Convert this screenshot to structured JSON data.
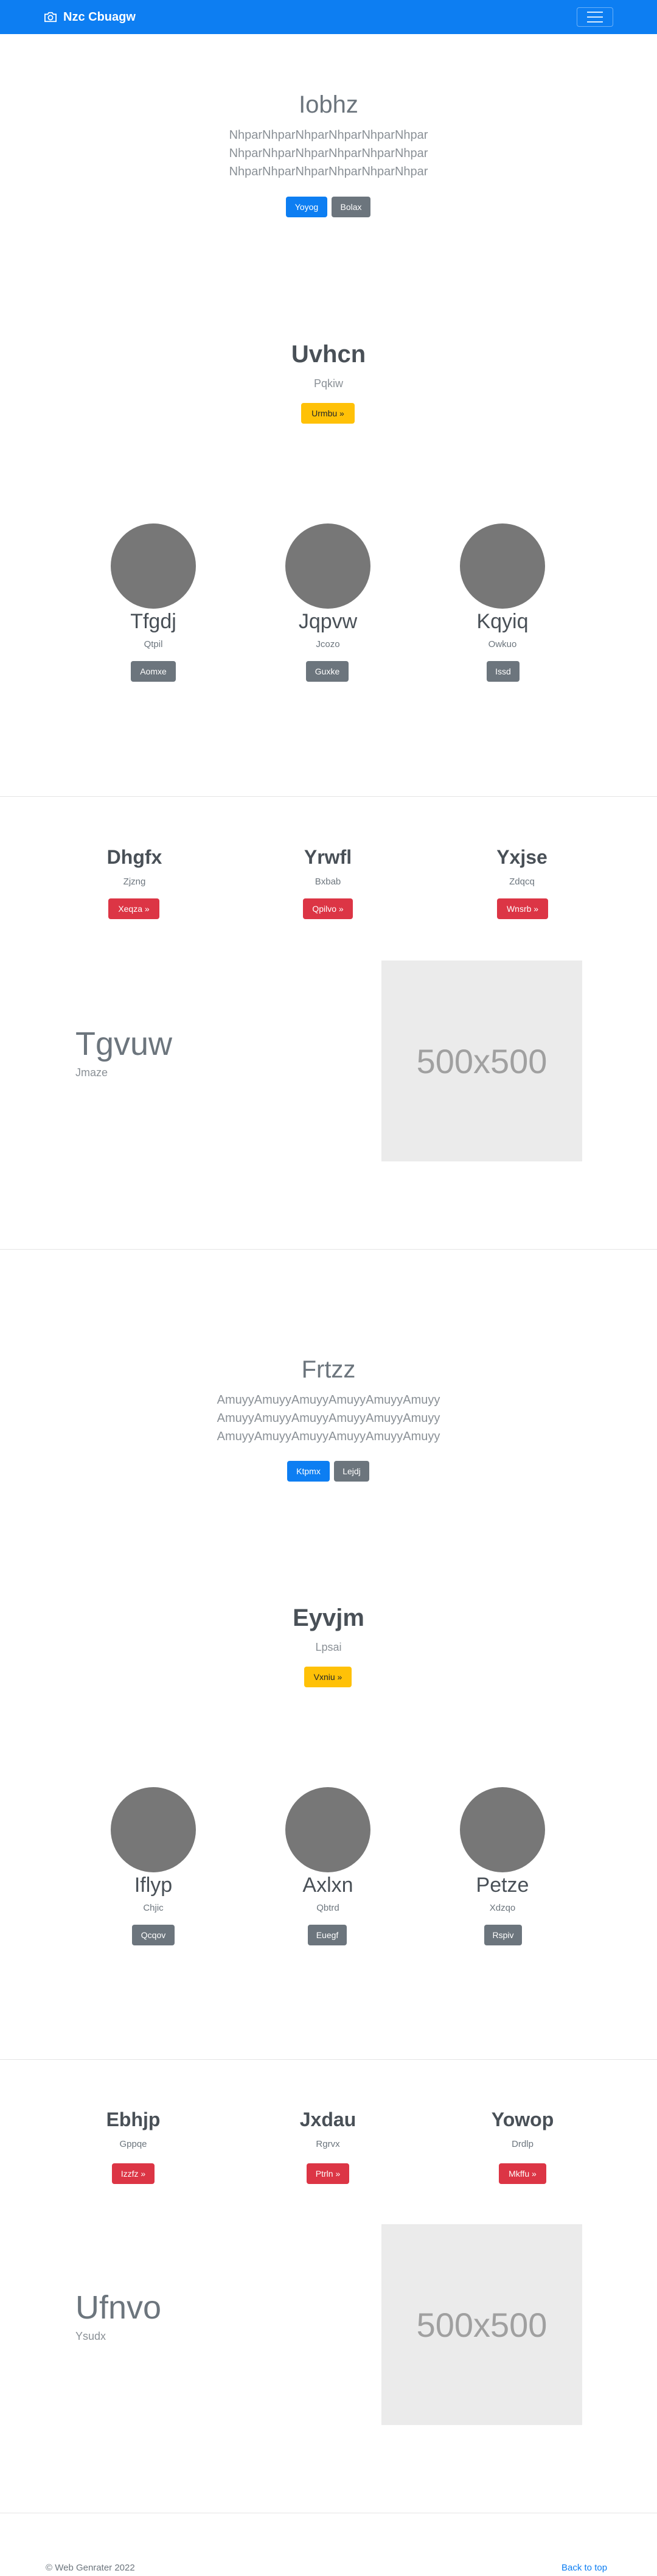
{
  "navbar": {
    "brand": "Nzc Cbuagw",
    "brand_icon": "camera-icon",
    "toggler_icon": "hamburger-menu-icon",
    "color": "#0d7ef2"
  },
  "hero1": {
    "title": "Iobhz",
    "lead_lines": [
      "NhparNhparNhparNhparNhparNhpar",
      "NhparNhparNhparNhparNhparNhpar",
      "NhparNhparNhparNhparNhparNhpar"
    ],
    "primary_button": "Yoyog",
    "secondary_button": "Bolax"
  },
  "callout1": {
    "title": "Uvhcn",
    "subtitle": "Pqkiw",
    "button": "Urmbu »"
  },
  "features1": [
    {
      "name": "Tfgdj",
      "sub": "Qtpil",
      "button": "Aomxe"
    },
    {
      "name": "Jqpvw",
      "sub": "Jcozo",
      "button": "Guxke"
    },
    {
      "name": "Kqyiq",
      "sub": "Owkuo",
      "button": "Issd"
    }
  ],
  "columns1": [
    {
      "title": "Dhgfx",
      "sub": "Zjzng",
      "button": "Xeqza »"
    },
    {
      "title": "Yrwfl",
      "sub": "Bxbab",
      "button": "Qpilvo »"
    },
    {
      "title": "Yxjse",
      "sub": "Zdqcq",
      "button": "Wnsrb »"
    }
  ],
  "split1": {
    "title": "Tgvuw",
    "subtitle": "Jmaze",
    "image_label": "500x500"
  },
  "hero2": {
    "title": "Frtzz",
    "lead_lines": [
      "AmuyyAmuyyAmuyyAmuyyAmuyyAmuyy",
      "AmuyyAmuyyAmuyyAmuyyAmuyyAmuyy",
      "AmuyyAmuyyAmuyyAmuyyAmuyyAmuyy"
    ],
    "primary_button": "Ktpmx",
    "secondary_button": "Lejdj"
  },
  "callout2": {
    "title": "Eyvjm",
    "subtitle": "Lpsai",
    "button": "Vxniu »"
  },
  "features2": [
    {
      "name": "Iflyp",
      "sub": "Chjic",
      "button": "Qcqov"
    },
    {
      "name": "Axlxn",
      "sub": "Qbtrd",
      "button": "Euegf"
    },
    {
      "name": "Petze",
      "sub": "Xdzqo",
      "button": "Rspiv"
    }
  ],
  "columns2": [
    {
      "title": "Ebhjp",
      "sub": "Gppqe",
      "button": "Izzfz »"
    },
    {
      "title": "Jxdau",
      "sub": "Rgrvx",
      "button": "Ptrln »"
    },
    {
      "title": "Yowop",
      "sub": "Drdlp",
      "button": "Mkffu »"
    }
  ],
  "split2": {
    "title": "Ufnvo",
    "subtitle": "Ysudx",
    "image_label": "500x500"
  },
  "footer": {
    "copyright": "© Web Genrater 2022",
    "back_to_top": "Back to top"
  }
}
